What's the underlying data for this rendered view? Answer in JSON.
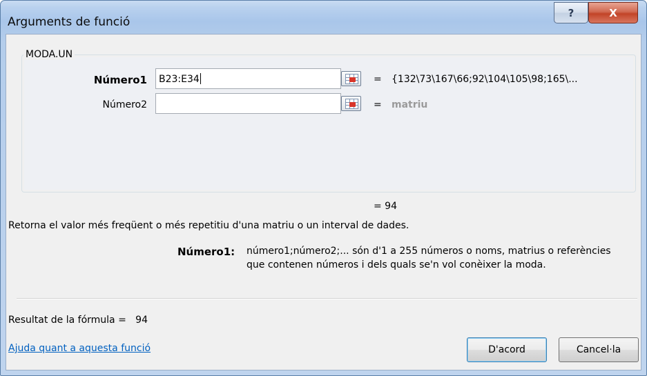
{
  "window": {
    "title": "Arguments de funció",
    "help_glyph": "?",
    "close_glyph": "X"
  },
  "function_group": {
    "name": "MODA.UN",
    "args": [
      {
        "label": "Número1",
        "value": "B23:E34",
        "result": "{132\\73\\167\\66;92\\104\\105\\98;165\\..."
      },
      {
        "label": "Número2",
        "value": "",
        "result": "matriu"
      }
    ]
  },
  "equals_sign": "=",
  "function_result": "= 94",
  "description": "Retorna el valor més freqüent o més repetitiu d'una matriu o un interval de dades.",
  "arg_help": {
    "label": "Número1:",
    "line1": "número1;número2;... són d'1 a 255 números o noms, matrius o referències",
    "line2": "que contenen números i dels quals se'n vol conèixer la moda."
  },
  "formula_result": "Resultat de la fórmula =   94",
  "help_link": "Ajuda quant a aquesta funció",
  "buttons": {
    "ok": "D'acord",
    "cancel": "Cancel·la"
  },
  "colors": {
    "titlebar": "#b9d1ee",
    "close_button": "#c24428",
    "link": "#0060c0",
    "hint_text": "#9a9a9a"
  }
}
